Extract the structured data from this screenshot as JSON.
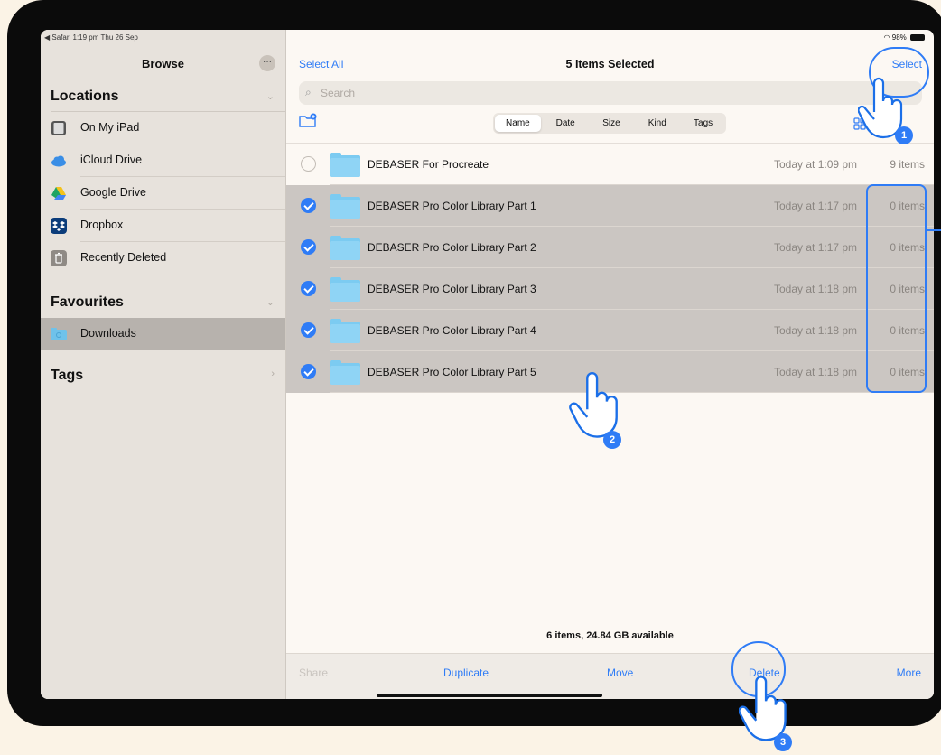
{
  "status": {
    "left": "◀ Safari  1:19 pm  Thu 26 Sep",
    "battery": "98%"
  },
  "sidebar": {
    "title": "Browse",
    "more": "···",
    "locations_header": "Locations",
    "locations": [
      {
        "label": "On My iPad",
        "icon": "ipad-icon"
      },
      {
        "label": "iCloud Drive",
        "icon": "icloud-icon"
      },
      {
        "label": "Google Drive",
        "icon": "google-drive-icon"
      },
      {
        "label": "Dropbox",
        "icon": "dropbox-icon"
      },
      {
        "label": "Recently Deleted",
        "icon": "trash-icon"
      }
    ],
    "favourites_header": "Favourites",
    "favourites": [
      {
        "label": "Downloads",
        "icon": "downloads-folder-icon"
      }
    ],
    "tags_header": "Tags"
  },
  "header": {
    "select_all": "Select All",
    "title": "5 Items Selected",
    "select": "Select"
  },
  "search": {
    "placeholder": "Search"
  },
  "sort": {
    "options": [
      "Name",
      "Date",
      "Size",
      "Kind",
      "Tags"
    ],
    "active": "Name"
  },
  "files": [
    {
      "name": "DEBASER For Procreate",
      "date": "Today at 1:09 pm",
      "count": "9 items",
      "selected": false
    },
    {
      "name": "DEBASER Pro Color Library Part 1",
      "date": "Today at 1:17 pm",
      "count": "0 items",
      "selected": true
    },
    {
      "name": "DEBASER Pro Color Library Part 2",
      "date": "Today at 1:17 pm",
      "count": "0 items",
      "selected": true
    },
    {
      "name": "DEBASER Pro Color Library Part 3",
      "date": "Today at 1:18 pm",
      "count": "0 items",
      "selected": true
    },
    {
      "name": "DEBASER Pro Color Library Part 4",
      "date": "Today at 1:18 pm",
      "count": "0 items",
      "selected": true
    },
    {
      "name": "DEBASER Pro Color Library Part 5",
      "date": "Today at 1:18 pm",
      "count": "0 items",
      "selected": true
    }
  ],
  "footer": {
    "info": "6 items, 24.84 GB available"
  },
  "toolbar": {
    "share": "Share",
    "duplicate": "Duplicate",
    "move": "Move",
    "delete": "Delete",
    "more": "More"
  },
  "annotations": {
    "step1": "1",
    "step2": "2",
    "step3": "3"
  },
  "colors": {
    "accent": "#2f7cf6",
    "selection": "#cbc6c2",
    "sidebar": "#e7e2dc",
    "background": "#fbf3e6"
  }
}
